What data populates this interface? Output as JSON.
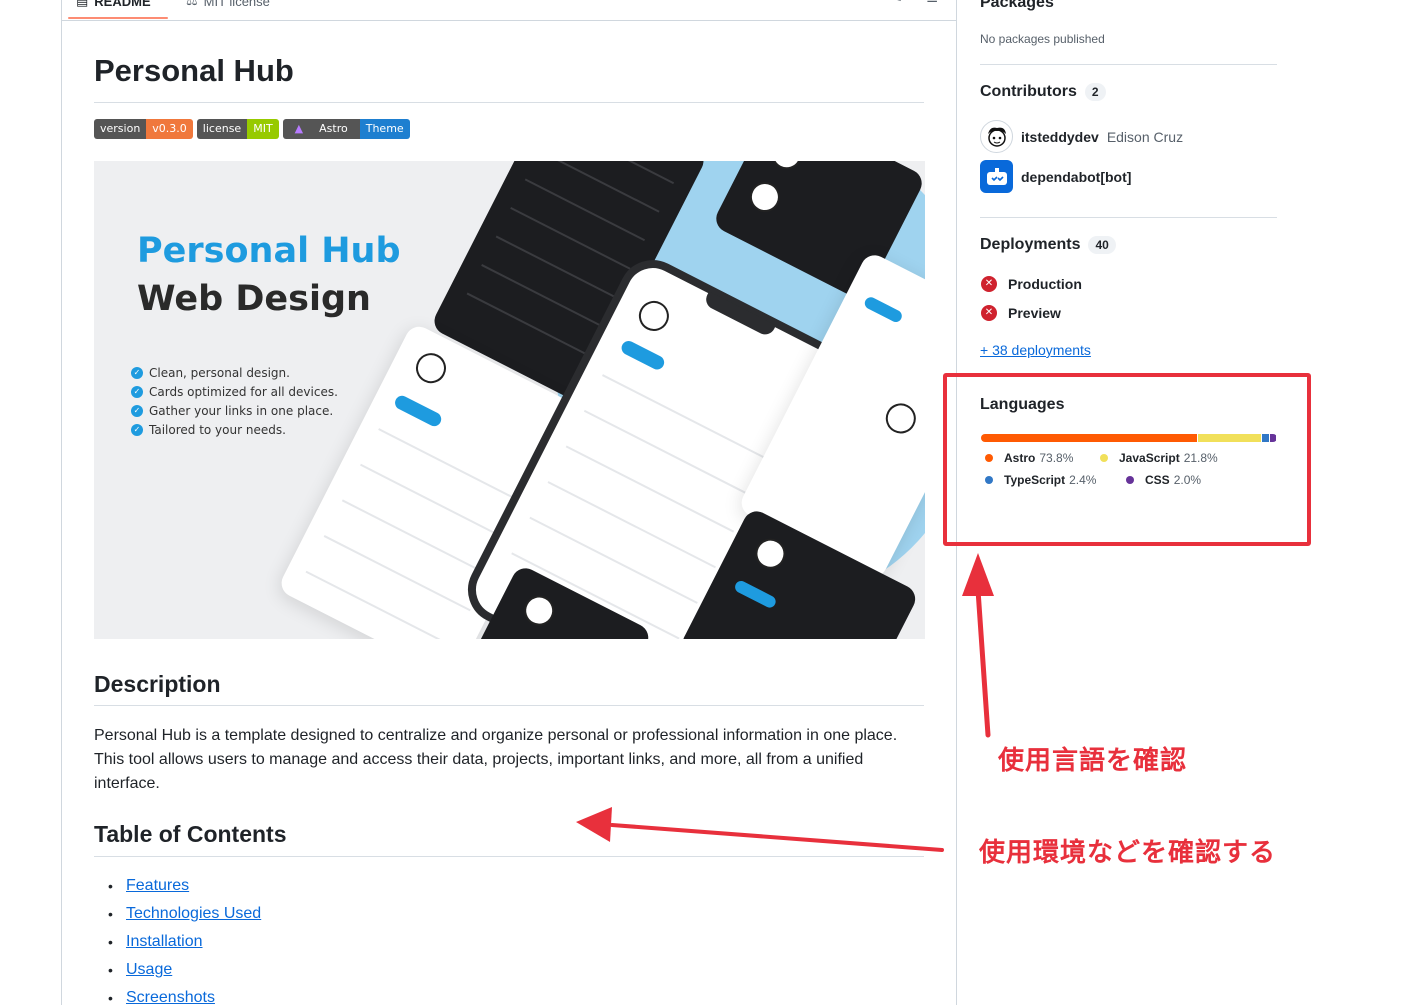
{
  "tabs": {
    "readme": "README",
    "license": "MIT license"
  },
  "readme": {
    "title": "Personal Hub",
    "badges": [
      {
        "label": "version",
        "value": "v0.3.0",
        "color": "#f0783c"
      },
      {
        "label": "license",
        "value": "MIT",
        "color": "#97ca00"
      },
      {
        "label": "Astro",
        "value": "Theme",
        "color": "#1e7fd0"
      }
    ],
    "hero": {
      "title": "Personal Hub",
      "subtitle": "Web Design",
      "bullets": [
        "Clean, personal design.",
        "Cards optimized for all devices.",
        "Gather your links in one place.",
        "Tailored to your needs."
      ]
    },
    "description_heading": "Description",
    "description": "Personal Hub is a template designed to centralize and organize personal or professional information in one place. This tool allows users to manage and access their data, projects, important links, and more, all from a unified interface.",
    "toc_heading": "Table of Contents",
    "toc": [
      "Features",
      "Technologies Used",
      "Installation",
      "Usage",
      "Screenshots"
    ]
  },
  "sidebar": {
    "packages_heading": "Packages",
    "packages_empty": "No packages published",
    "contributors_heading": "Contributors",
    "contributors_count": "2",
    "contributors": [
      {
        "login": "itsteddydev",
        "name": "Edison Cruz"
      },
      {
        "login": "dependabot[bot]",
        "name": ""
      }
    ],
    "deployments_heading": "Deployments",
    "deployments_count": "40",
    "deployments": [
      "Production",
      "Preview"
    ],
    "deployments_more": "+ 38 deployments",
    "languages_heading": "Languages",
    "languages": [
      {
        "name": "Astro",
        "percent": "73.8%",
        "value": 73.8,
        "color": "#ff5a03"
      },
      {
        "name": "JavaScript",
        "percent": "21.8%",
        "value": 21.8,
        "color": "#f1e05a"
      },
      {
        "name": "TypeScript",
        "percent": "2.4%",
        "value": 2.4,
        "color": "#3178c6"
      },
      {
        "name": "CSS",
        "percent": "2.0%",
        "value": 2.0,
        "color": "#663399"
      }
    ]
  },
  "annotations": {
    "languages_note": "使用言語を確認",
    "environment_note": "使用環境などを確認する",
    "color": "#e8303c"
  }
}
